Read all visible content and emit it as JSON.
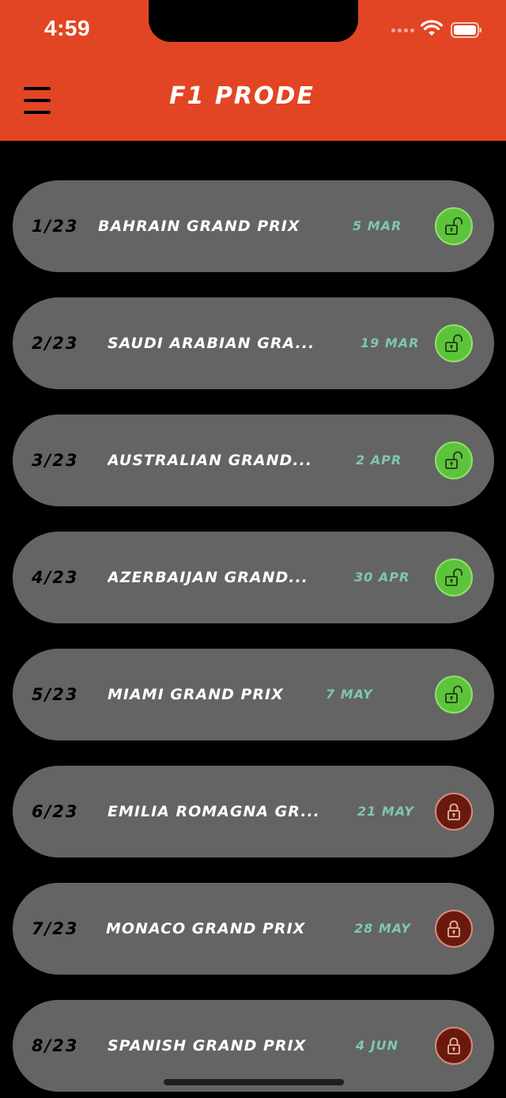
{
  "status_bar": {
    "time": "4:59"
  },
  "header": {
    "title": "F1 PRODE",
    "menu_icon": "hamburger-menu-icon",
    "background_color": "#e24524"
  },
  "colors": {
    "row_background": "#646464",
    "date_color": "#7fc7b1",
    "unlocked_badge": "#5ec33c",
    "locked_badge": "#6a1a0c"
  },
  "races": [
    {
      "round": "1/23",
      "name": "BAHRAIN GRAND PRIX",
      "date": "5 MAR",
      "status": "unlocked"
    },
    {
      "round": "2/23",
      "name": "SAUDI ARABIAN GRA...",
      "date": "19 MAR",
      "status": "unlocked"
    },
    {
      "round": "3/23",
      "name": "AUSTRALIAN GRAND...",
      "date": "2 APR",
      "status": "unlocked"
    },
    {
      "round": "4/23",
      "name": "AZERBAIJAN GRAND...",
      "date": "30 APR",
      "status": "unlocked"
    },
    {
      "round": "5/23",
      "name": "MIAMI GRAND PRIX",
      "date": "7 MAY",
      "status": "unlocked"
    },
    {
      "round": "6/23",
      "name": "EMILIA ROMAGNA GR...",
      "date": "21 MAY",
      "status": "locked"
    },
    {
      "round": "7/23",
      "name": "MONACO GRAND PRIX",
      "date": "28 MAY",
      "status": "locked"
    },
    {
      "round": "8/23",
      "name": "SPANISH GRAND PRIX",
      "date": "4 JUN",
      "status": "locked"
    }
  ]
}
